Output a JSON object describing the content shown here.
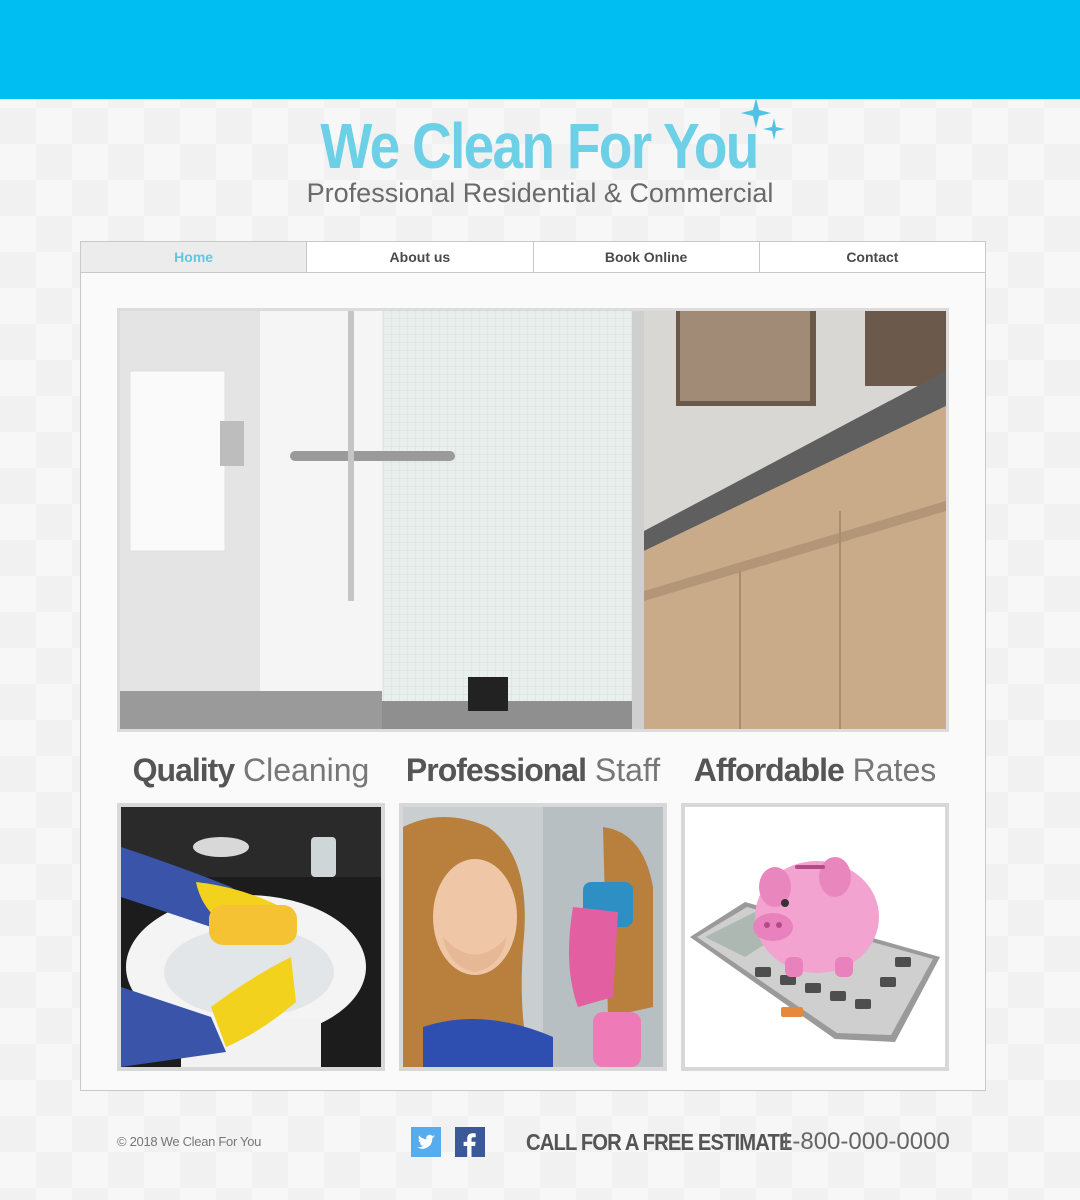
{
  "header": {
    "title": "We Clean For You",
    "subtitle": "Professional Residential & Commercial",
    "accent_color": "#00bdf2",
    "logo_color": "#6dd0e6"
  },
  "nav": {
    "items": [
      {
        "label": "Home",
        "active": true
      },
      {
        "label": "About us",
        "active": false
      },
      {
        "label": "Book Online",
        "active": false
      },
      {
        "label": "Contact",
        "active": false
      }
    ]
  },
  "hero": {
    "image": "modern-bathroom-photo"
  },
  "features": [
    {
      "strong": "Quality",
      "light": "Cleaning",
      "image": "sink-cleaning-photo"
    },
    {
      "strong": "Professional",
      "light": "Staff",
      "image": "cleaning-staff-photo"
    },
    {
      "strong": "Affordable",
      "light": "Rates",
      "image": "piggy-bank-calculator-photo"
    }
  ],
  "footer": {
    "copyright": "© 2018 We Clean For You",
    "social": [
      {
        "name": "twitter-icon",
        "color": "#55acee"
      },
      {
        "name": "facebook-icon",
        "color": "#3b5998"
      }
    ],
    "cta_label": "CALL FOR A FREE ESTIMATE",
    "phone": "1-800-000-0000"
  }
}
